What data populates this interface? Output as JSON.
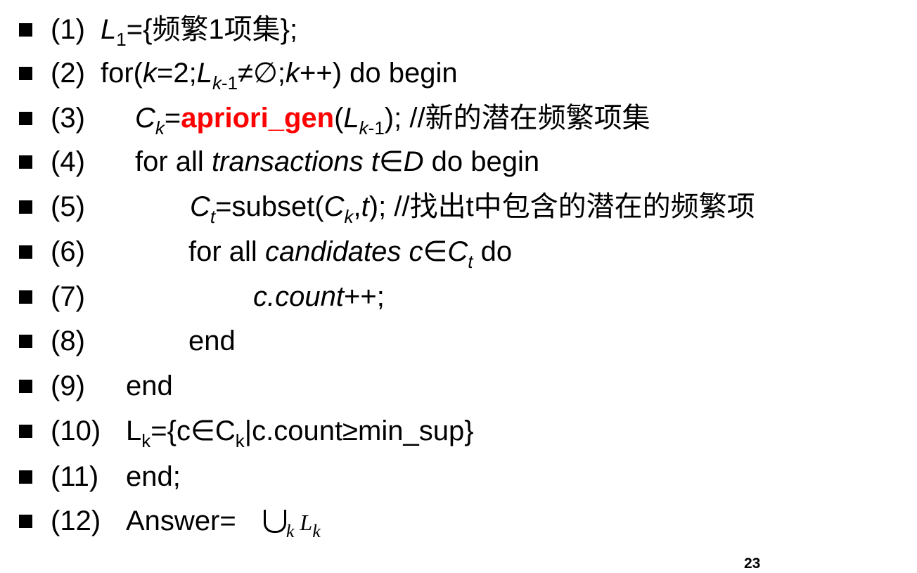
{
  "lines": [
    {
      "num": "(1)",
      "a": "L",
      "b": "1",
      "c": "={频繁1项集};"
    },
    {
      "num": "(2)",
      "a": "for(",
      "b": "k",
      "c": "=2;",
      "d": "L",
      "e": "k",
      "f": "-1",
      "g": "≠∅;",
      "h": "k",
      "i": "++) do begin"
    },
    {
      "num": "(3)",
      "a": "C",
      "b": "k",
      "c": "=",
      "d": "apriori_gen",
      "e": "(",
      "f": "L",
      "g": "k",
      "h": "-1",
      "i": ");  //新的潜在频繁项集"
    },
    {
      "num": "(4)",
      "a": "for all ",
      "b": "transactions t",
      "c": "∈",
      "d": "D",
      "e": " do begin"
    },
    {
      "num": "(5)",
      "a": "C",
      "b": "t",
      "c": "=subset(",
      "d": "C",
      "e": "k",
      "f": ",",
      "g": "t",
      "h": ");    //找出t中包含的潜在的频繁项"
    },
    {
      "num": "(6)",
      "a": "for all ",
      "b": "candidates c",
      "c": "∈",
      "d": "C",
      "e": "t",
      "f": " do"
    },
    {
      "num": "(7)",
      "a": "c.count",
      "b": "++;"
    },
    {
      "num": "(8)",
      "a": "end"
    },
    {
      "num": "(9)",
      "a": "end"
    },
    {
      "num": "(10)",
      "a": "L",
      "b": "k",
      "c": "={c",
      "d": "∈",
      "e": "C",
      "f": "k",
      "g": "|c.count≥min_sup}"
    },
    {
      "num": "(11)",
      "a": "end;"
    },
    {
      "num": "(12)",
      "a": "Answer= ",
      "b": "k",
      "c": "L",
      "d": "k"
    }
  ],
  "page_number": "23"
}
